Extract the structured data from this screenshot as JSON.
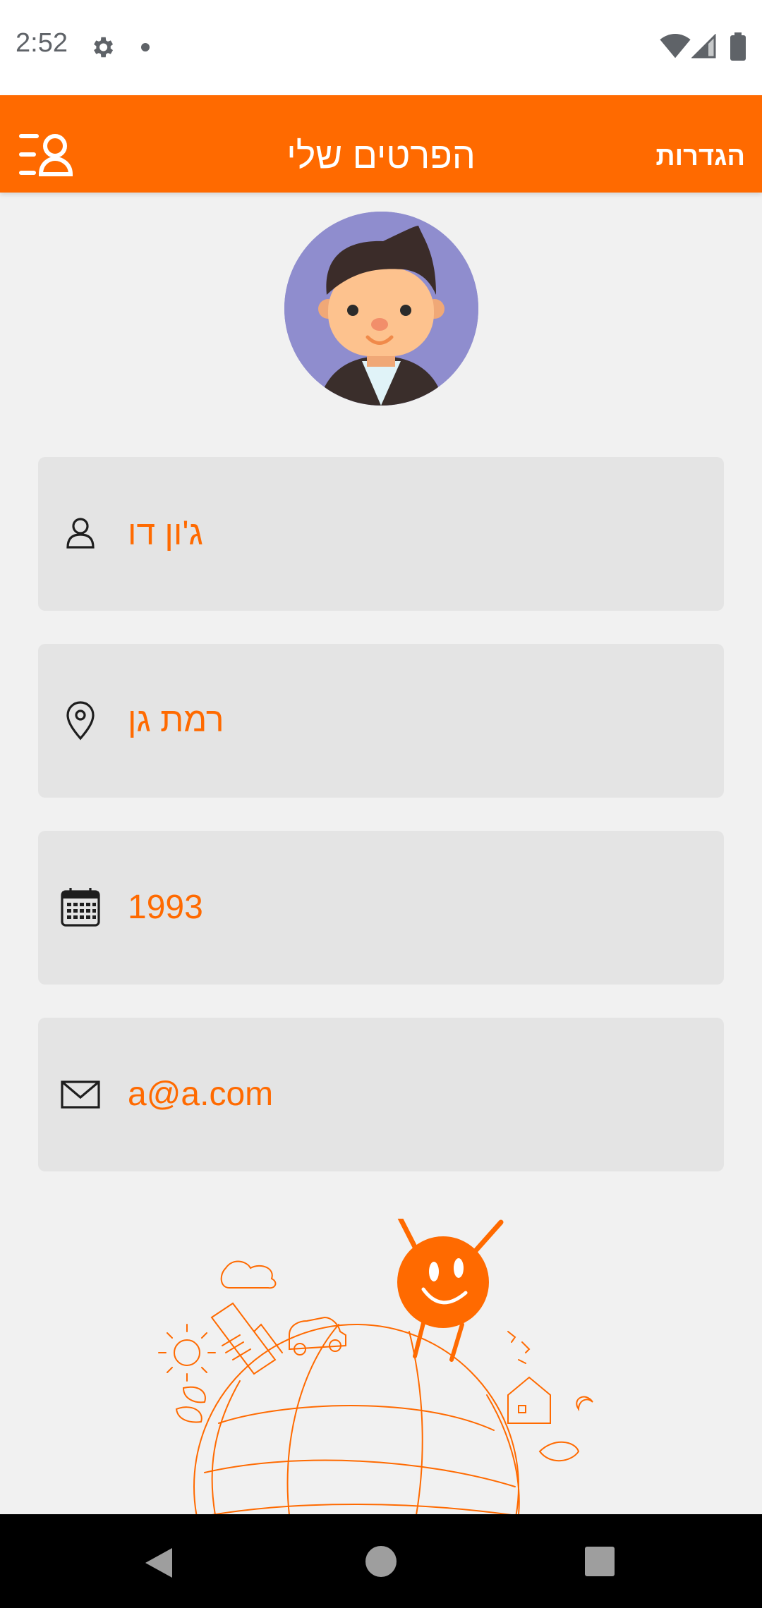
{
  "status_bar": {
    "time": "2:52",
    "icons": [
      "settings-icon",
      "notification-dot",
      "wifi-icon",
      "signal-icon",
      "battery-icon"
    ]
  },
  "app_bar": {
    "title": "הפרטים שלי",
    "settings_label": "הגדרות",
    "menu_icon": "profile-menu-icon",
    "background_color": "#ff6a00"
  },
  "avatar": {
    "icon": "user-avatar-cartoon"
  },
  "fields": [
    {
      "icon": "person-icon",
      "value": "ג'ון דו"
    },
    {
      "icon": "location-pin-icon",
      "value": "רמת גן"
    },
    {
      "icon": "calendar-icon",
      "value": "1993"
    },
    {
      "icon": "mail-icon",
      "value": "a@a.com"
    }
  ],
  "colors": {
    "accent": "#ff6a00",
    "field_background": "#e4e4e4",
    "page_background": "#f1f1f1"
  },
  "nav_bar": {
    "icons": [
      "back-icon",
      "home-icon",
      "recents-icon"
    ]
  }
}
